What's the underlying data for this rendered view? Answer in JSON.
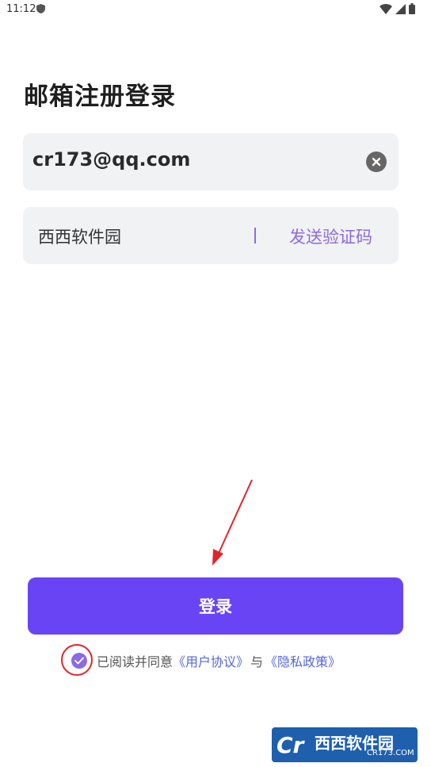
{
  "status_bar": {
    "time": "11:12",
    "icons": [
      "shield-icon",
      "wifi-icon",
      "signal-icon",
      "battery-icon"
    ]
  },
  "page": {
    "title": "邮箱注册登录"
  },
  "email_field": {
    "value": "cr173@qq.com",
    "clear_icon": "close-icon"
  },
  "code_field": {
    "value": "西西软件园",
    "send_code_label": "发送验证码"
  },
  "login_button": {
    "label": "登录"
  },
  "agreement": {
    "prefix": "已阅读并同意",
    "user_agreement": "《用户协议》",
    "conjunction": "与",
    "privacy_policy": "《隐私政策》",
    "checked": true
  },
  "watermark": {
    "brand": "西西软件园",
    "domain": "CR173.COM"
  },
  "colors": {
    "accent": "#6944f5",
    "link": "#5567d9",
    "highlight_ring": "#e0252a",
    "field_bg": "#f1f2f4"
  }
}
